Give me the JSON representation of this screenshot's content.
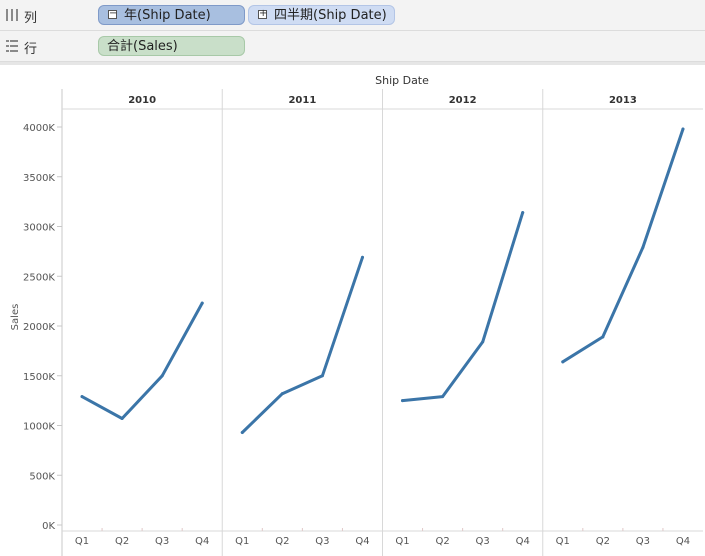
{
  "shelves": {
    "columns": {
      "label": "列",
      "pills": [
        {
          "label": "年(Ship Date)",
          "toggle": "−"
        },
        {
          "label": "四半期(Ship Date)",
          "toggle": "+"
        }
      ]
    },
    "rows": {
      "label": "行",
      "pills": [
        {
          "label": "合計(Sales)"
        }
      ]
    }
  },
  "colors": {
    "line": "#3b75a8",
    "pill_dark": "#a8bfe0",
    "pill_light": "#cfdcf3",
    "pill_green": "#c9dfc9"
  },
  "chart_data": {
    "type": "line",
    "title": "Ship Date",
    "ylabel": "Sales",
    "xlabel": "",
    "ylim": [
      0,
      4000000
    ],
    "yticks": [
      0,
      500000,
      1000000,
      1500000,
      2000000,
      2500000,
      3000000,
      3500000,
      4000000
    ],
    "ytick_labels": [
      "0K",
      "500K",
      "1000K",
      "1500K",
      "2000K",
      "2500K",
      "3000K",
      "3500K",
      "4000K"
    ],
    "categories": [
      "Q1",
      "Q2",
      "Q3",
      "Q4"
    ],
    "panels": [
      {
        "year": "2010",
        "values": [
          1290000,
          1070000,
          1500000,
          2230000
        ]
      },
      {
        "year": "2011",
        "values": [
          930000,
          1320000,
          1500000,
          2690000
        ]
      },
      {
        "year": "2012",
        "values": [
          1250000,
          1290000,
          1840000,
          3140000
        ]
      },
      {
        "year": "2013",
        "values": [
          1640000,
          1890000,
          2790000,
          3980000
        ]
      }
    ],
    "grid": false,
    "legend": "none"
  }
}
